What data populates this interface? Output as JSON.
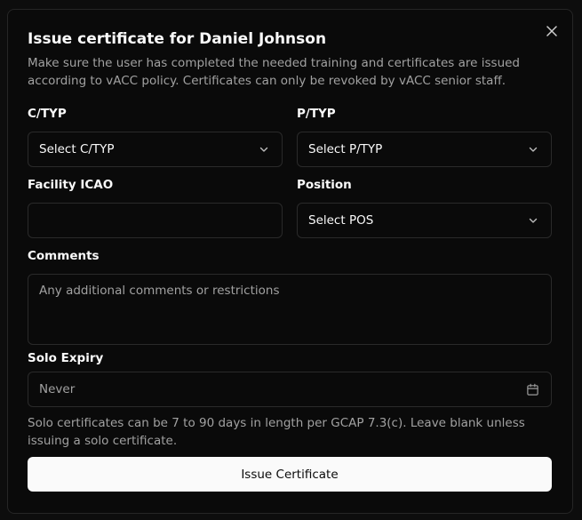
{
  "dialog": {
    "title": "Issue certificate for Daniel Johnson",
    "description": "Make sure the user has completed the needed training and certificates are issued according to vACC policy. Certificates can only be revoked by vACC senior staff."
  },
  "form": {
    "ctyp": {
      "label": "C/TYP",
      "value": "Select C/TYP"
    },
    "ptyp": {
      "label": "P/TYP",
      "value": "Select P/TYP"
    },
    "facility": {
      "label": "Facility ICAO",
      "value": ""
    },
    "position": {
      "label": "Position",
      "value": "Select POS"
    },
    "comments": {
      "label": "Comments",
      "placeholder": "Any additional comments or restrictions"
    },
    "solo_expiry": {
      "label": "Solo Expiry",
      "value": "Never"
    },
    "help_text": "Solo certificates can be 7 to 90 days in length per GCAP 7.3(c). Leave blank unless issuing a solo certificate.",
    "submit_label": "Issue Certificate"
  },
  "icons": {
    "close": "close-icon",
    "chevron": "chevron-down-icon",
    "calendar": "calendar-icon"
  },
  "colors": {
    "background": "#0a0a0a",
    "text": "#fafafa",
    "muted": "#a1a1a1",
    "border": "#2a2a2a",
    "button_bg": "#fafafa",
    "button_text": "#0a0a0a"
  }
}
